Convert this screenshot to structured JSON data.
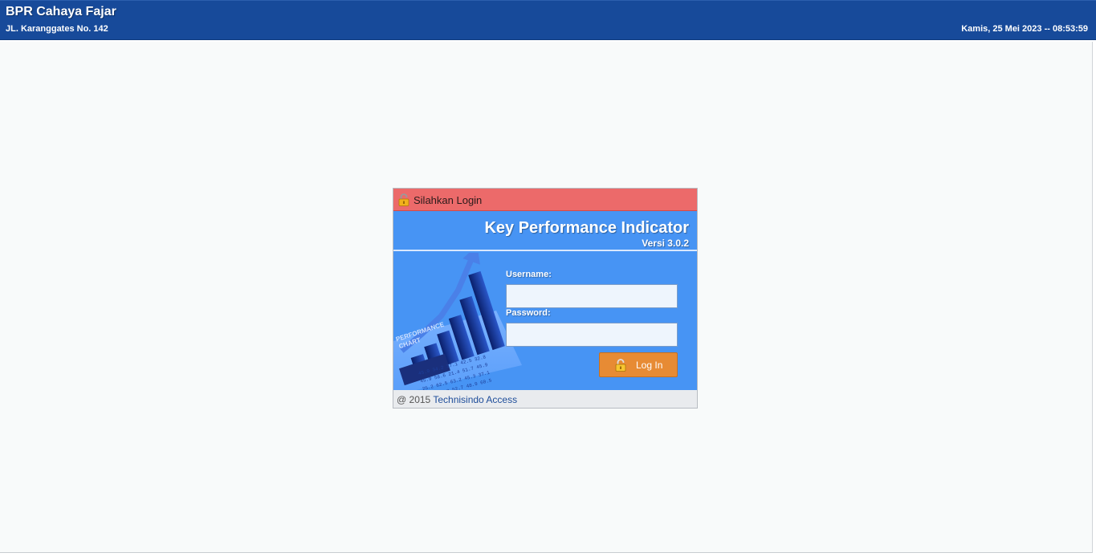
{
  "header": {
    "company_name": "BPR Cahaya Fajar",
    "company_address": "JL. Karanggates No. 142",
    "datetime": "Kamis, 25 Mei 2023 -- 08:53:59"
  },
  "login": {
    "panel_title": "Silahkan Login",
    "app_title": "Key Performance Indicator",
    "app_version": "Versi 3.0.2",
    "username_label": "Username:",
    "username_value": "",
    "password_label": "Password:",
    "password_value": "",
    "login_button_label": "Log In",
    "header_icon": "lock-icon",
    "button_icon": "lock-icon",
    "illustration": "performance-chart-image",
    "illustration_labels": [
      "PERFORMANCE",
      "CHART"
    ],
    "illustration_numbers": [
      "45.9",
      "34.2",
      "37.1",
      "42.5",
      "32.8",
      "45.9",
      "58.6",
      "21.4",
      "51.7",
      "45.9",
      "25.2",
      "62.5",
      "63.2",
      "45.3",
      "37.1",
      "35.3",
      "41.8",
      "52.7",
      "48.9",
      "60.5"
    ]
  },
  "footer": {
    "copyright_prefix": "@ 2015",
    "company_link": "Technisindo Access"
  },
  "colors": {
    "topbar": "#174a9a",
    "login_header": "#ec6a6a",
    "login_body": "#4794f4",
    "login_button": "#e78b34"
  }
}
